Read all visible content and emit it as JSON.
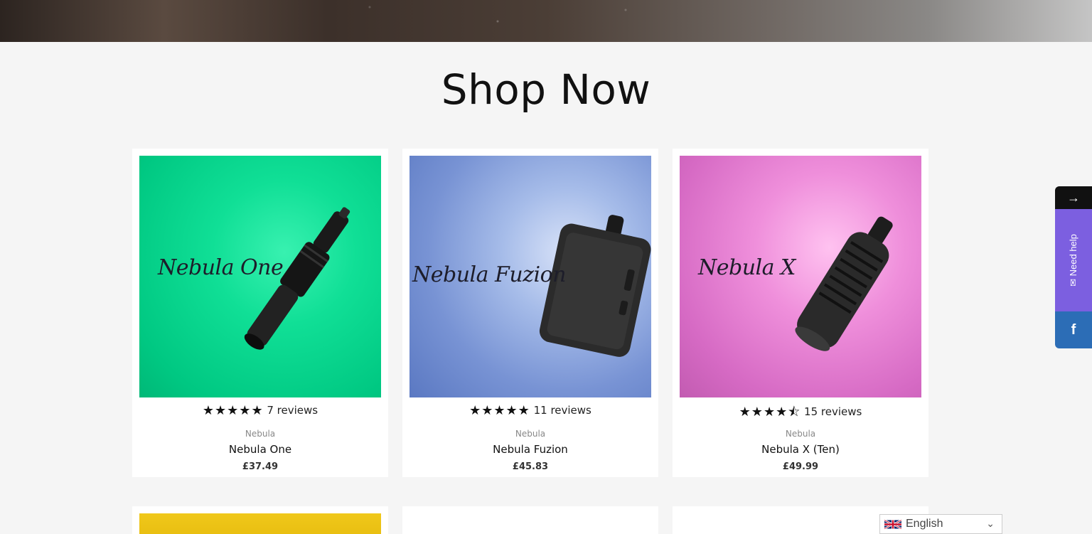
{
  "section": {
    "title": "Shop Now"
  },
  "products": [
    {
      "script_label": "Nebula One",
      "stars": "★★★★★",
      "reviews": "7 reviews",
      "vendor": "Nebula",
      "name": "Nebula One",
      "price": "£37.49",
      "rating": 5,
      "bg": "#00d68f"
    },
    {
      "script_label": "Nebula Fuzion",
      "stars": "★★★★★",
      "reviews": "11 reviews",
      "vendor": "Nebula",
      "name": "Nebula Fuzion",
      "price": "£45.83",
      "rating": 5,
      "bg": "#7d9ad8"
    },
    {
      "script_label": "Nebula X",
      "stars": "★★★★⯪",
      "reviews": "15 reviews",
      "vendor": "Nebula",
      "name": "Nebula X (Ten)",
      "price": "£49.99",
      "rating": 4.5,
      "bg": "#e17ad0"
    }
  ],
  "help_widget": {
    "arrow": "→",
    "label": "Need help",
    "facebook": "f"
  },
  "language": {
    "selected": "English"
  },
  "colors": {
    "help_purple": "#7c5fe0",
    "facebook_blue": "#2c6db6"
  }
}
